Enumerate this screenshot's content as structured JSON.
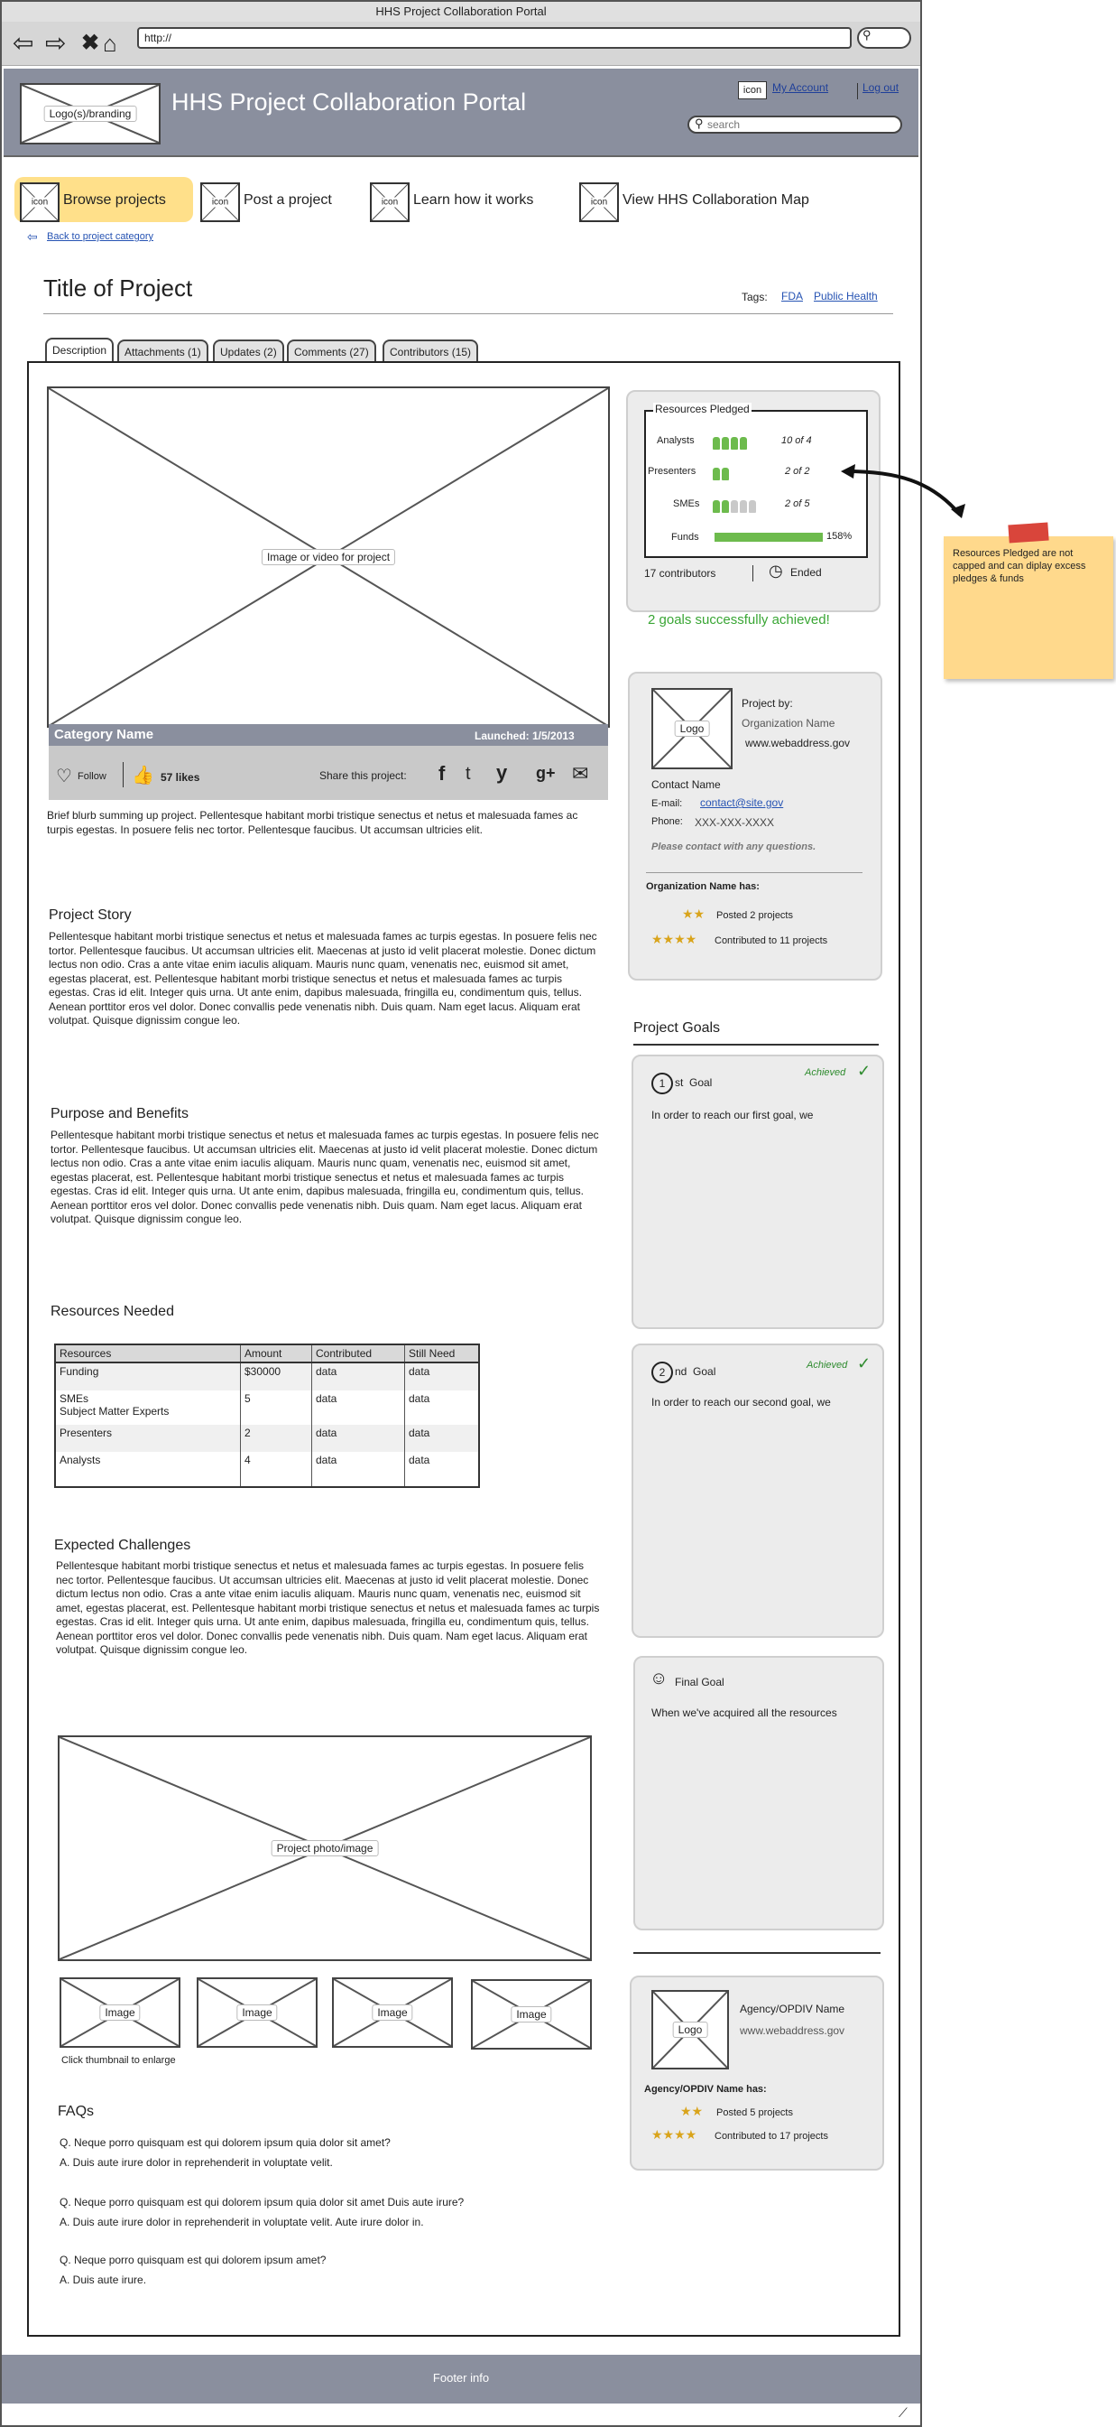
{
  "browser": {
    "title": "HHS Project Collaboration Portal",
    "url": "http://"
  },
  "header": {
    "logo": "Logo(s)/branding",
    "title": "HHS Project Collaboration Portal",
    "icon_label": "icon",
    "my_account": "My Account",
    "logout": "Log out",
    "search_placeholder": "search"
  },
  "nav": {
    "items": [
      {
        "icon": "icon",
        "label": "Browse projects"
      },
      {
        "icon": "icon",
        "label": "Post a project"
      },
      {
        "icon": "icon",
        "label": "Learn how it works"
      },
      {
        "icon": "icon",
        "label": "View HHS Collaboration Map"
      }
    ],
    "back_link": "Back to project category"
  },
  "project": {
    "title": "Title of Project",
    "tags_label": "Tags:",
    "tags": [
      "FDA",
      "Public Health"
    ],
    "tabs": [
      "Description",
      "Attachments (1)",
      "Updates (2)",
      "Comments (27)",
      "Contributors (15)"
    ],
    "media_label": "Image or video for project",
    "category": "Category Name",
    "launched": "Launched: 1/5/2013",
    "follow": "Follow",
    "likes": "57 likes",
    "share_label": "Share this project:",
    "blurb": "Brief blurb summing up project. Pellentesque habitant morbi tristique senectus et netus et malesuada fames ac turpis egestas. In posuere felis nec tortor. Pellentesque faucibus. Ut accumsan ultricies elit.",
    "story_title": "Project Story",
    "story": "Pellentesque habitant morbi tristique senectus et netus et malesuada fames ac turpis egestas. In posuere felis nec tortor. Pellentesque faucibus. Ut accumsan ultricies elit. Maecenas at justo id velit placerat molestie. Donec dictum lectus non odio. Cras a ante vitae enim iaculis aliquam. Mauris nunc quam, venenatis nec, euismod sit amet, egestas placerat, est. Pellentesque habitant morbi tristique senectus et netus et malesuada fames ac turpis egestas. Cras id elit. Integer quis urna. Ut ante enim, dapibus malesuada, fringilla eu, condimentum quis, tellus. Aenean porttitor eros vel dolor. Donec convallis pede venenatis nibh. Duis quam. Nam eget lacus. Aliquam erat volutpat. Quisque dignissim congue leo.",
    "purpose_title": "Purpose and Benefits",
    "purpose": "Pellentesque habitant morbi tristique senectus et netus et malesuada fames ac turpis egestas. In posuere felis nec tortor. Pellentesque faucibus. Ut accumsan ultricies elit. Maecenas at justo id velit placerat molestie. Donec dictum lectus non odio. Cras a ante vitae enim iaculis aliquam. Mauris nunc quam, venenatis nec, euismod sit amet, egestas placerat, est. Pellentesque habitant morbi tristique senectus et netus et malesuada fames ac turpis egestas. Cras id elit. Integer quis urna. Ut ante enim, dapibus malesuada, fringilla eu, condimentum quis, tellus. Aenean porttitor eros vel dolor. Donec convallis pede venenatis nibh. Duis quam. Nam eget lacus. Aliquam erat volutpat. Quisque dignissim congue leo.",
    "resources_title": "Resources Needed",
    "resources_headers": [
      "Resources",
      "Amount",
      "Contributed",
      "Still Need"
    ],
    "resources_rows": [
      [
        "Funding",
        "$30000",
        "data",
        "data"
      ],
      [
        "SMEs\nSubject Matter Experts",
        "5",
        "data",
        "data"
      ],
      [
        "Presenters",
        "2",
        "data",
        "data"
      ],
      [
        "Analysts",
        "4",
        "data",
        "data"
      ]
    ],
    "challenges_title": "Expected Challenges",
    "challenges": "Pellentesque habitant morbi tristique senectus et netus et malesuada fames ac turpis egestas. In posuere felis nec tortor. Pellentesque faucibus. Ut accumsan ultricies elit. Maecenas at justo id velit placerat molestie. Donec dictum lectus non odio. Cras a ante vitae enim iaculis aliquam. Mauris nunc quam, venenatis nec, euismod sit amet, egestas placerat, est. Pellentesque habitant morbi tristique senectus et netus et malesuada fames ac turpis egestas. Cras id elit. Integer quis urna. Ut ante enim, dapibus malesuada, fringilla eu, condimentum quis, tellus. Aenean porttitor eros vel dolor. Donec convallis pede venenatis nibh. Duis quam. Nam eget lacus. Aliquam erat volutpat. Quisque dignissim congue leo.",
    "photo_label": "Project photo/image",
    "thumb_label": "Image",
    "thumb_hint": "Click thumbnail to enlarge",
    "faqs_title": "FAQs",
    "faqs": [
      {
        "q": "Q. Neque porro quisquam est qui dolorem ipsum quia dolor sit amet?",
        "a": "A. Duis aute irure dolor in reprehenderit in voluptate velit."
      },
      {
        "q": "Q. Neque porro quisquam est qui dolorem ipsum quia dolor sit amet Duis aute irure?",
        "a": "A. Duis aute irure dolor in reprehenderit in voluptate velit. Aute irure dolor in."
      },
      {
        "q": "Q. Neque porro quisquam est qui dolorem ipsum amet?",
        "a": "A. Duis aute irure."
      }
    ]
  },
  "resources_pledged": {
    "title": "Resources Pledged",
    "rows": [
      {
        "label": "Analysts",
        "filled": 4,
        "total": 4,
        "text": "10 of 4"
      },
      {
        "label": "Presenters",
        "filled": 2,
        "total": 2,
        "text": "2 of 2"
      },
      {
        "label": "SMEs",
        "filled": 2,
        "total": 5,
        "text": "2 of 5"
      }
    ],
    "funds_label": "Funds",
    "funds_percent": "158%",
    "funds_fill": 1.0,
    "contributors": "17 contributors",
    "ended": "Ended",
    "achieved_text": "2 goals successfully achieved!",
    "colors": {
      "filled": "#6dbb4d",
      "empty": "#c9c9c9"
    }
  },
  "note": "Resources Pledged are not capped and can diplay excess pledges & funds",
  "org": {
    "logo": "Logo",
    "project_by": "Project by:",
    "org_name": "Organization Name",
    "web": "www.webaddress.gov",
    "contact_name": "Contact Name",
    "email_label": "E-mail:",
    "email": "contact@site.gov",
    "phone_label": "Phone:",
    "phone": "XXX-XXX-XXXX",
    "contact_note": "Please contact with any questions.",
    "has_title": "Organization Name has:",
    "posted": "Posted 2 projects",
    "contributed": "Contributed to 11 projects"
  },
  "goals": {
    "title": "Project Goals",
    "items": [
      {
        "num": "1",
        "suffix": "st  Goal",
        "status": "Achieved",
        "text": "In order to reach our first goal, we"
      },
      {
        "num": "2",
        "suffix": "nd  Goal",
        "status": "Achieved",
        "text": "In order to reach our second goal, we"
      }
    ],
    "final_title": "Final Goal",
    "final_text": "When we've acquired all the resources"
  },
  "agency": {
    "logo": "Logo",
    "name": "Agency/OPDIV Name",
    "web": "www.webaddress.gov",
    "has_title": "Agency/OPDIV Name has:",
    "posted": "Posted 5 projects",
    "contributed": "Contributed to 17 projects"
  },
  "footer": {
    "text": "Footer info"
  }
}
